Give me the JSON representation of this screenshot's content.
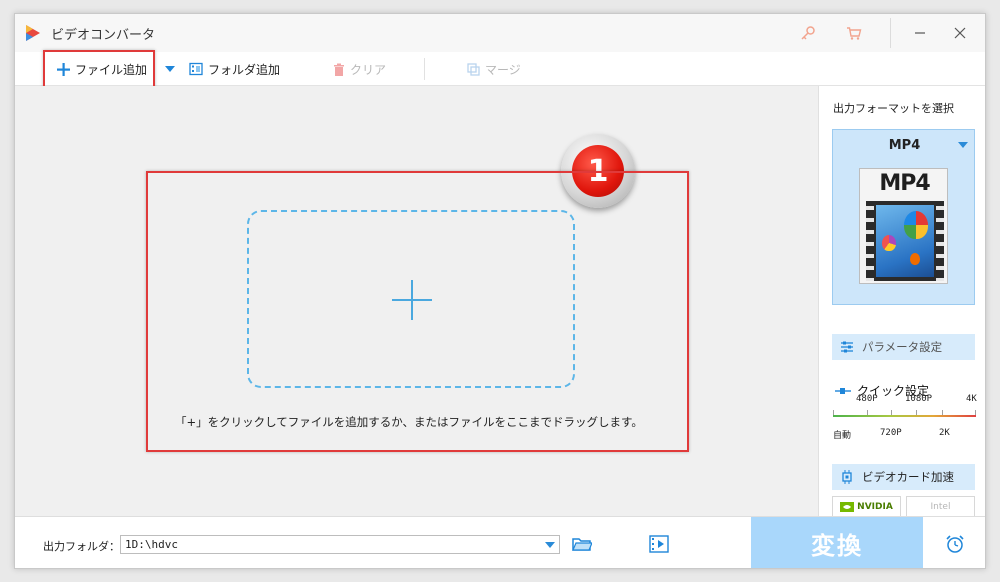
{
  "window": {
    "title": "ビデオコンバータ"
  },
  "toolbar": {
    "add_file_label": "ファイル追加",
    "add_folder_label": "フォルダ追加",
    "clear_label": "クリア",
    "merge_label": "マージ"
  },
  "badge": {
    "number": "1"
  },
  "drop": {
    "hint": "「+」をクリックしてファイルを追加するか、またはファイルをここまでドラッグします。"
  },
  "right_panel": {
    "title": "出力フォーマットを選択",
    "format_name": "MP4",
    "format_thumb_label": "MP4",
    "param_label": "パラメータ設定",
    "quick_label": "クイック設定",
    "quick_top_labels": [
      "480P",
      "1080P",
      "4K"
    ],
    "quick_bottom_labels": [
      "自動",
      "720P",
      "2K"
    ],
    "gpu_label": "ビデオカード加速",
    "vendors": [
      "NVIDIA",
      "Intel"
    ]
  },
  "bottom": {
    "output_label": "出力フォルダ：",
    "output_path": "1D:\\hdvc",
    "convert_label": "変換"
  },
  "colors": {
    "accent": "#2a8bd8",
    "convert_bg": "#a9d7fb",
    "highlight_red": "#e03a3a",
    "badge_red": "#e0160c"
  }
}
